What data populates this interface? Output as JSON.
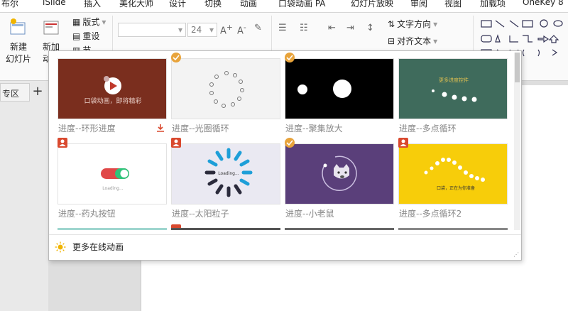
{
  "ribbon_tabs": [
    "布尔",
    "iSlide",
    "插入",
    "美化大师",
    "设计",
    "切换",
    "动画",
    "口袋动画 PA",
    "幻灯片放映",
    "审阅",
    "视图",
    "加载项",
    "OneKey 8"
  ],
  "ribbon": {
    "new_slide_label": "新建",
    "new_slide_label2": "幻灯片",
    "new_anim_label": "新加",
    "new_anim_label2": "动画",
    "layout_label": "版式",
    "reset_label": "重设",
    "section_label": "节",
    "font_name_placeholder": "",
    "font_size": "24",
    "text_direction": "文字方向",
    "align_text": "对齐文本"
  },
  "panel": {
    "section_tab": "专区",
    "add_label": "+"
  },
  "gallery": {
    "items": [
      {
        "label": "进度--环形进度",
        "badge": "none",
        "download": true,
        "thumb_text": "口袋动画，即将精彩"
      },
      {
        "label": "进度--光圈循环",
        "badge": "check"
      },
      {
        "label": "进度--聚集放大",
        "badge": "check"
      },
      {
        "label": "进度--多点循环",
        "badge": "none",
        "thumb_text": "更多进度控件"
      },
      {
        "label": "进度--药丸按钮",
        "badge": "user",
        "thumb_text": "Loading..."
      },
      {
        "label": "进度--太阳粒子",
        "badge": "user",
        "thumb_text": "Loading..."
      },
      {
        "label": "进度--小老鼠",
        "badge": "check"
      },
      {
        "label": "进度--多点循环2",
        "badge": "user",
        "thumb_text": "口袋，正在为你准备"
      }
    ],
    "more_online": "更多在线动画"
  },
  "colors": {
    "brown": "#7a2e1e",
    "dark_teal": "#3f6b5c",
    "purple": "#5a3f7a",
    "yellow": "#f7cd0a",
    "orange_badge": "#e8a33a",
    "red_badge": "#d9492f"
  }
}
